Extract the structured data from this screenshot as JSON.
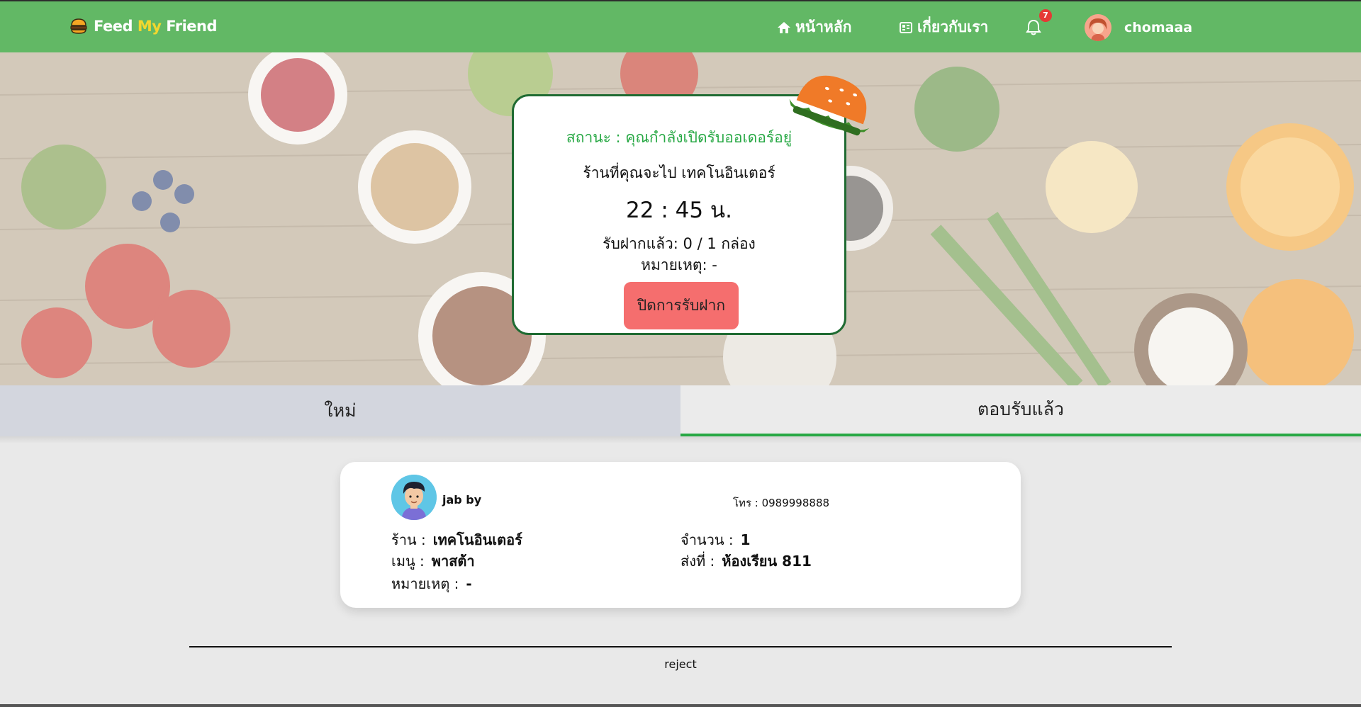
{
  "navbar": {
    "brand_part1": "Feed ",
    "brand_part2": "My",
    "brand_part3": " Friend",
    "home_label": "หน้าหลัก",
    "about_label": "เกี่ยวกับเรา",
    "notification_count": "7",
    "username": "chomaaa",
    "colors": {
      "navbar": "#62b865",
      "brand_highlight": "#f2d72e",
      "badge": "#e53935"
    }
  },
  "status_card": {
    "status_text": "สถานะ : คุณกำลังเปิดรับออเดอร์อยู่",
    "shop_text": "ร้านที่คุณจะไป เทคโนอินเตอร์",
    "time_text": "22 : 45 น.",
    "count_text": "รับฝากแล้ว: 0 / 1 กล่อง",
    "note_text": "หมายเหตุ: -",
    "close_button_label": "ปิดการรับฝาก",
    "colors": {
      "border": "#1f6b32",
      "status": "#27a844",
      "button": "#f56e6e"
    }
  },
  "tabs": {
    "new_label": "ใหม่",
    "accepted_label": "ตอบรับแล้ว",
    "active": "accepted"
  },
  "order": {
    "customer_name": "jab by",
    "phone_text": "โทร : 0989998888",
    "shop_label": "ร้าน :",
    "shop_value": "เทคโนอินเตอร์",
    "menu_label": "เมนู :",
    "menu_value": "พาสต้า",
    "note_label": "หมายเหตุ :",
    "note_value": "-",
    "qty_label": "จำนวน :",
    "qty_value": "1",
    "dest_label": "ส่งที่ :",
    "dest_value": "ห้องเรียน 811"
  },
  "footer": {
    "text": "reject"
  },
  "icons": [
    "burger-logo-icon",
    "home-icon",
    "about-icon",
    "bell-icon",
    "user-avatar",
    "burger-decoration-icon",
    "customer-avatar"
  ]
}
